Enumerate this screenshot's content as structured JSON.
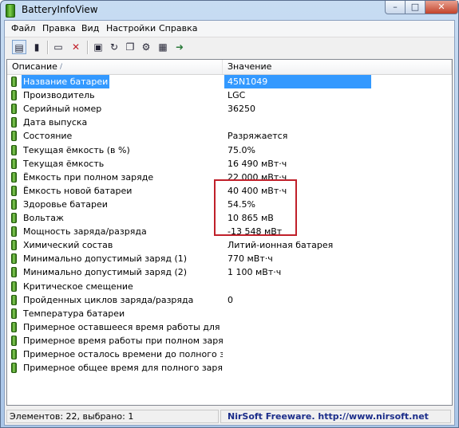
{
  "window": {
    "title": "BatteryInfoView",
    "min_label": "–",
    "max_label": "□",
    "close_label": "✕"
  },
  "menu": [
    {
      "label": "Файл"
    },
    {
      "label": "Правка"
    },
    {
      "label": "Вид"
    },
    {
      "label": "Настройки"
    },
    {
      "label": "Справка"
    }
  ],
  "toolbar_icons": [
    "list-view-icon",
    "battery-view-icon",
    "properties-icon",
    "delete-icon",
    "save-icon",
    "refresh-icon",
    "copy-icon",
    "settings-icon",
    "report-icon",
    "exit-icon"
  ],
  "columns": {
    "name": "Описание",
    "value": "Значение",
    "sort_indicator": "/"
  },
  "rows": [
    {
      "name": "Название батареи",
      "value": "45N1049",
      "selected": true
    },
    {
      "name": "Производитель",
      "value": "LGC"
    },
    {
      "name": "Серийный номер",
      "value": "36250"
    },
    {
      "name": "Дата выпуска",
      "value": ""
    },
    {
      "name": "Состояние",
      "value": "Разряжается"
    },
    {
      "name": "Текущая ёмкость (в %)",
      "value": "75.0%"
    },
    {
      "name": "Текущая ёмкость",
      "value": "16 490 мВт·ч"
    },
    {
      "name": "Ёмкость при полном заряде",
      "value": "22 000 мВт·ч"
    },
    {
      "name": "Ёмкость новой батареи",
      "value": "40 400 мВт·ч"
    },
    {
      "name": "Здоровье батареи",
      "value": "54.5%"
    },
    {
      "name": "Вольтаж",
      "value": "10 865 мВ"
    },
    {
      "name": "Мощность заряда/разряда",
      "value": "-13 548 мВт"
    },
    {
      "name": "Химический состав",
      "value": "Литий-ионная батарея"
    },
    {
      "name": "Минимально допустимый заряд (1)",
      "value": "770 мВт·ч"
    },
    {
      "name": "Минимально допустимый заряд (2)",
      "value": "1 100 мВт·ч"
    },
    {
      "name": "Критическое смещение",
      "value": ""
    },
    {
      "name": "Пройденных циклов заряда/разряда",
      "value": "0"
    },
    {
      "name": "Температура батареи",
      "value": ""
    },
    {
      "name": "Примерное оставшееся время работы для теку...",
      "value": ""
    },
    {
      "name": "Примерное время работы при полном заряде д...",
      "value": ""
    },
    {
      "name": "Примерное осталось времени до полного заряд...",
      "value": ""
    },
    {
      "name": "Примерное общее время для полного заряда б...",
      "value": ""
    }
  ],
  "status": {
    "left": "Элементов: 22, выбрано: 1",
    "right": "NirSoft Freeware.  http://www.nirsoft.net"
  },
  "colors": {
    "selection": "#3399ff",
    "highlight_box": "#c0202a",
    "status_link": "#1b2d8a"
  }
}
